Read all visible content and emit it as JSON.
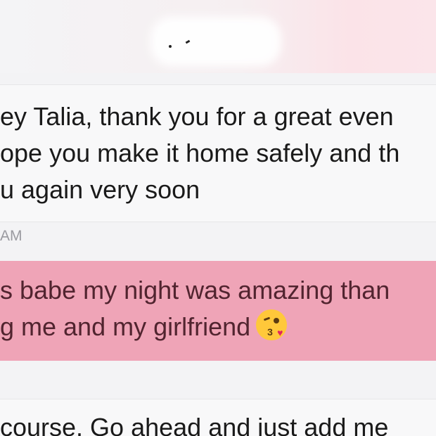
{
  "conversation": {
    "header": {
      "redacted_contact": "· ‐"
    },
    "messages": [
      {
        "direction": "incoming",
        "lines": [
          "ey Talia, thank you for a great even",
          "ope you make it home safely and th",
          "u again very soon"
        ]
      },
      {
        "direction": "outgoing",
        "lines": [
          "s babe my night was amazing than",
          "g me and my girlfriend"
        ],
        "emoji": "kissing-face-with-heart-icon"
      },
      {
        "direction": "incoming",
        "lines": [
          " course. Go ahead and just add me"
        ]
      }
    ],
    "timestamp": "AM",
    "colors": {
      "incoming_bubble": "#f8f8f9",
      "outgoing_bubble": "#efa4b7",
      "outgoing_text": "#51242f",
      "incoming_text": "#1a1a1a"
    }
  }
}
